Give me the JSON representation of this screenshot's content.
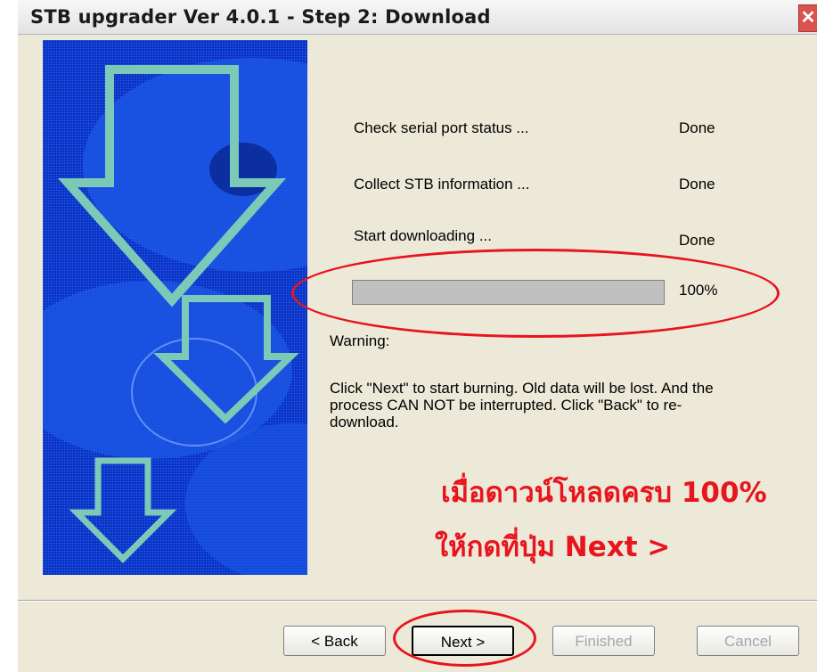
{
  "window": {
    "title": "STB upgrader Ver 4.0.1 - Step 2: Download",
    "close_glyph": "✕"
  },
  "steps": [
    {
      "label": "Check serial port status ...",
      "status": "Done"
    },
    {
      "label": "Collect STB information ...",
      "status": "Done"
    },
    {
      "label": "Start downloading ...",
      "status": "Done"
    }
  ],
  "progress": {
    "value": 1.0,
    "label": "100%"
  },
  "warning": {
    "title": "Warning:",
    "body": "Click \"Next\" to start burning. Old data will be lost. And the process CAN NOT be interrupted. Click \"Back\" to re-download."
  },
  "annotation": {
    "line1": "เมื่อดาวน์โหลดครบ 100%",
    "line2": "ให้กดที่ปุ่ม Next >",
    "color": "#e8141e"
  },
  "buttons": {
    "back": "< Back",
    "next": "Next >",
    "finished": "Finished",
    "cancel": "Cancel"
  },
  "icons": {
    "art": "down-arrows-disc-art",
    "close": "close-icon"
  }
}
